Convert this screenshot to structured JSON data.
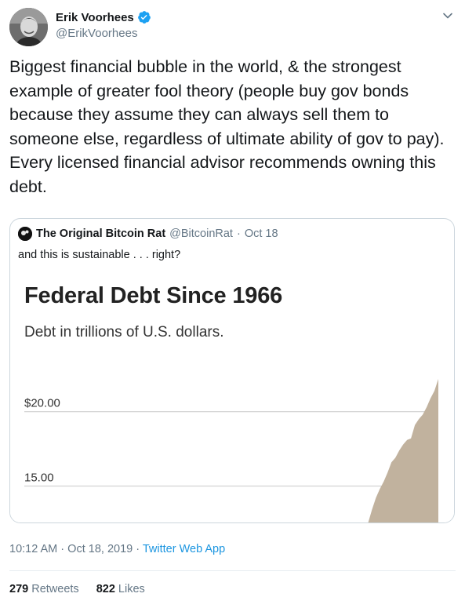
{
  "author": {
    "name": "Erik Voorhees",
    "handle": "@ErikVoorhees",
    "verified_icon": "verified-badge-icon",
    "verified_color": "#1da1f2"
  },
  "tweet": {
    "text": "Biggest financial bubble in the world, & the strongest example of greater fool theory (people buy gov bonds because they assume they can always sell them to someone else, regardless of ultimate ability of gov to pay). Every licensed financial advisor recommends owning this debt."
  },
  "quote": {
    "name": "The Original Bitcoin Rat",
    "handle": "@BitcoinRat",
    "separator": "·",
    "date": "Oct 18",
    "text": "and this is sustainable . . . right?"
  },
  "chart_data": {
    "type": "area",
    "title": "Federal Debt Since 1966",
    "subtitle": "Debt in trillions of U.S. dollars.",
    "ytick_labels": [
      "$20.00",
      "15.00"
    ],
    "yticks": [
      20,
      15
    ],
    "ylim": [
      12.5,
      22.2
    ],
    "xlim": [
      1966,
      2019
    ],
    "grid": true,
    "fill_color": "#c1b29e",
    "series": [
      {
        "x": [
          2010.0,
          2010.5,
          2011.0,
          2011.5,
          2012.0,
          2012.5,
          2013.0,
          2013.5,
          2014.0,
          2014.5,
          2015.0,
          2015.5,
          2016.0,
          2016.5,
          2017.0,
          2017.5,
          2018.0,
          2018.5,
          2019.0
        ],
        "y": [
          12.5,
          13.4,
          14.2,
          14.8,
          15.3,
          15.9,
          16.6,
          16.9,
          17.4,
          17.8,
          18.1,
          18.2,
          19.1,
          19.5,
          19.8,
          20.3,
          20.9,
          21.4,
          22.2
        ]
      }
    ]
  },
  "meta": {
    "time": "10:12 AM",
    "separator": "·",
    "date": "Oct 18, 2019",
    "app": "Twitter Web App"
  },
  "stats": {
    "retweets_count": "279",
    "retweets_label": "Retweets",
    "likes_count": "822",
    "likes_label": "Likes"
  },
  "icons": {
    "caret": "chevron-down-icon"
  }
}
